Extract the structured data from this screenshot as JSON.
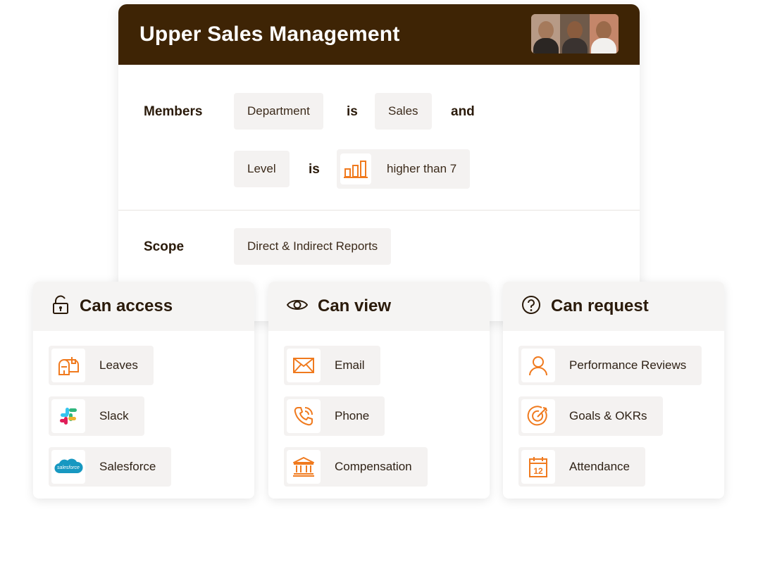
{
  "header": {
    "title": "Upper Sales Management"
  },
  "members": {
    "label": "Members",
    "rule1": {
      "field": "Department",
      "op": "is",
      "value": "Sales",
      "join": "and"
    },
    "rule2": {
      "field": "Level",
      "op": "is",
      "value": "higher than 7",
      "icon": "bar-chart-icon"
    }
  },
  "scope": {
    "label": "Scope",
    "value": "Direct & Indirect Reports"
  },
  "accent_color": "#f07a1e",
  "header_color": "#3e2405",
  "permissions": {
    "access": {
      "title": "Can access",
      "icon": "unlock-icon",
      "items": [
        {
          "label": "Leaves",
          "icon": "mailbox-icon"
        },
        {
          "label": "Slack",
          "icon": "slack-logo-icon"
        },
        {
          "label": "Salesforce",
          "icon": "salesforce-logo-icon",
          "logo_text": "salesforce"
        }
      ]
    },
    "view": {
      "title": "Can view",
      "icon": "eye-icon",
      "items": [
        {
          "label": "Email",
          "icon": "envelope-icon"
        },
        {
          "label": "Phone",
          "icon": "phone-icon"
        },
        {
          "label": "Compensation",
          "icon": "bank-icon"
        }
      ]
    },
    "request": {
      "title": "Can request",
      "icon": "question-circle-icon",
      "items": [
        {
          "label": "Performance Reviews",
          "icon": "person-icon"
        },
        {
          "label": "Goals & OKRs",
          "icon": "target-icon"
        },
        {
          "label": "Attendance",
          "icon": "calendar-icon",
          "calendar_day": "12"
        }
      ]
    }
  }
}
